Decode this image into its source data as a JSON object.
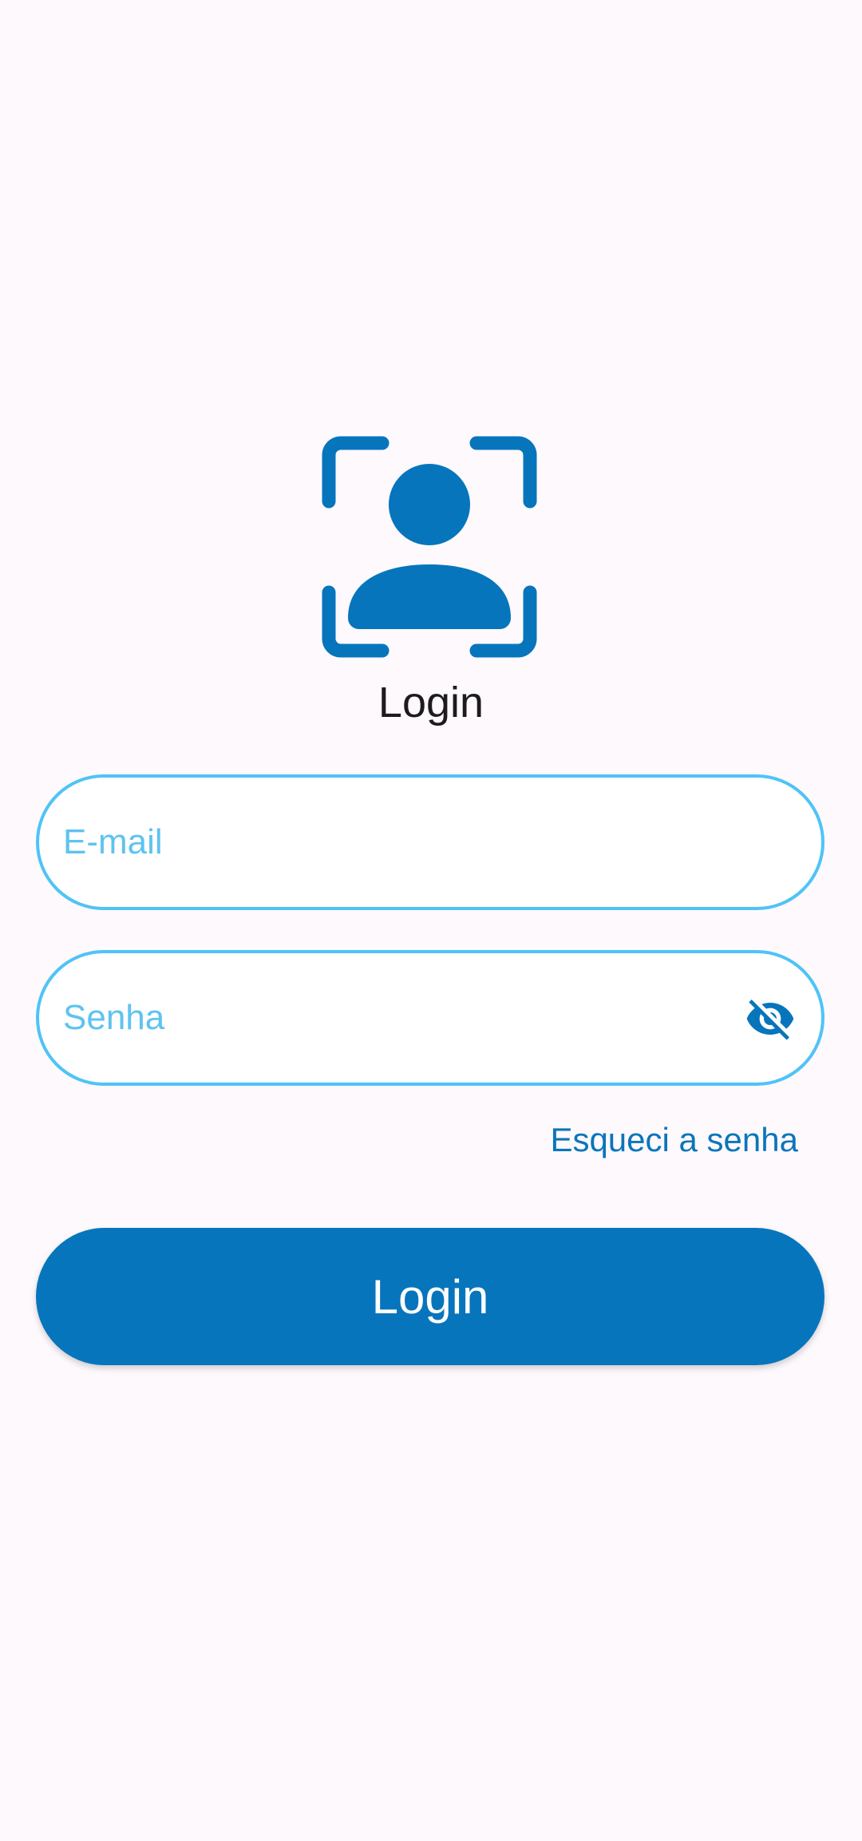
{
  "header": {
    "logo_icon": "face-scan-user-icon",
    "title": "Login"
  },
  "form": {
    "email": {
      "placeholder": "E-mail",
      "value": ""
    },
    "password": {
      "placeholder": "Senha",
      "value": "",
      "toggle_icon": "visibility-off-icon"
    },
    "forgot_password_label": "Esqueci a senha",
    "submit_label": "Login"
  },
  "colors": {
    "primary": "#0775bc",
    "field_border": "#4fc3f7",
    "placeholder": "#5ec3f0",
    "background": "#fdf9fc",
    "title_text": "#1d1b20"
  }
}
